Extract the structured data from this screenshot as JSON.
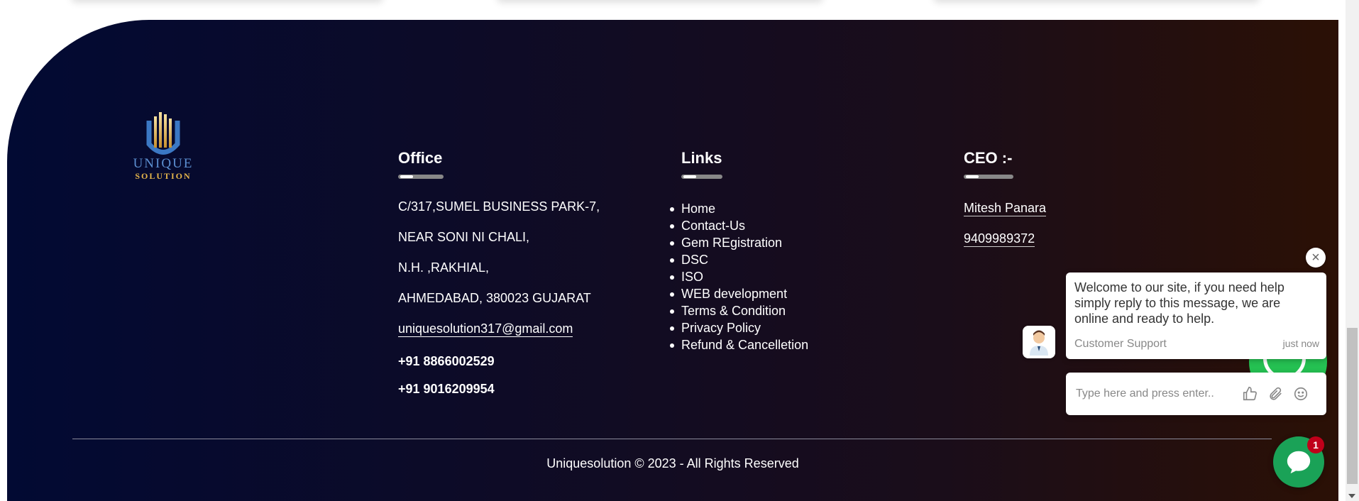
{
  "logo": {
    "brand_top": "UNIQUE",
    "brand_bottom": "SOLUTION"
  },
  "office": {
    "heading": "Office",
    "address_lines": [
      "C/317,SUMEL BUSINESS PARK-7,",
      "NEAR SONI NI CHALI,",
      "N.H. ,RAKHIAL,",
      "AHMEDABAD, 380023 GUJARAT"
    ],
    "email": "uniquesolution317@gmail.com",
    "phones": [
      "+91 8866002529",
      "+91 9016209954"
    ]
  },
  "links": {
    "heading": "Links",
    "items": [
      "Home",
      "Contact-Us",
      "Gem REgistration",
      "DSC",
      "ISO",
      "WEB development",
      "Terms & Condition",
      "Privacy Policy",
      "Refund & Cancelletion"
    ]
  },
  "ceo": {
    "heading": "CEO :-",
    "name": "Mitesh Panara",
    "phone": "9409989372"
  },
  "copyright": "Uniquesolution © 2023 - All Rights Reserved",
  "chat": {
    "close_icon": "×",
    "message": "Welcome to our site, if you need help simply reply to this message, we are online and ready to help.",
    "sender": "Customer Support",
    "time": "just now",
    "input_placeholder": "Type here and press enter..",
    "badge_count": "1",
    "icons": [
      "thumbs-up-icon",
      "paperclip-icon",
      "smiley-icon"
    ]
  },
  "colors": {
    "footer_start": "#020a33",
    "footer_end": "#2b1005",
    "chat_green": "#1aa257",
    "badge_red": "#c0001a"
  }
}
